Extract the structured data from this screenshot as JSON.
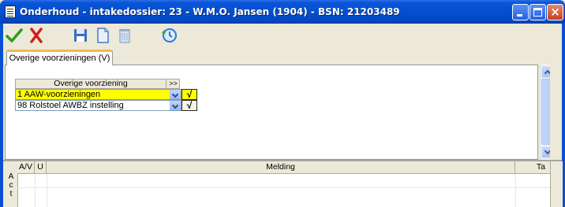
{
  "window": {
    "title": "Onderhoud - intakedossier: 23 - W.M.O. Jansen (1904) - BSN: 21203489",
    "caption_buttons": [
      "minimize",
      "maximize",
      "close"
    ]
  },
  "toolbar": {
    "buttons": [
      {
        "icon": "checkmark-icon",
        "color": "#2e9c1e"
      },
      {
        "icon": "cancel-x-icon",
        "color": "#d21e1e"
      },
      {
        "icon": "save-disk-icon",
        "color": "#3a6cc4"
      },
      {
        "icon": "new-document-icon",
        "color": "#4a78c8"
      },
      {
        "icon": "trash-icon",
        "color": "#8ea6cc"
      },
      {
        "icon": "refresh-clock-icon",
        "color": "#2a7ad8"
      }
    ]
  },
  "tabs": [
    {
      "label": "Overige voorzieningen (V)",
      "active": true
    }
  ],
  "grid": {
    "header": "Overige voorziening",
    "more_label": ">>",
    "rows": [
      {
        "value": "1 AAW-voorzieningen",
        "selected": true,
        "confirm_label": "√"
      },
      {
        "value": "98 Rolstoel AWBZ instelling",
        "selected": false,
        "confirm_label": "√"
      }
    ],
    "selected_row_color": "#ffff00"
  },
  "bottom_panel": {
    "side_label": "A c t",
    "columns": [
      "A/V",
      "U",
      "Melding",
      "Ta"
    ]
  }
}
